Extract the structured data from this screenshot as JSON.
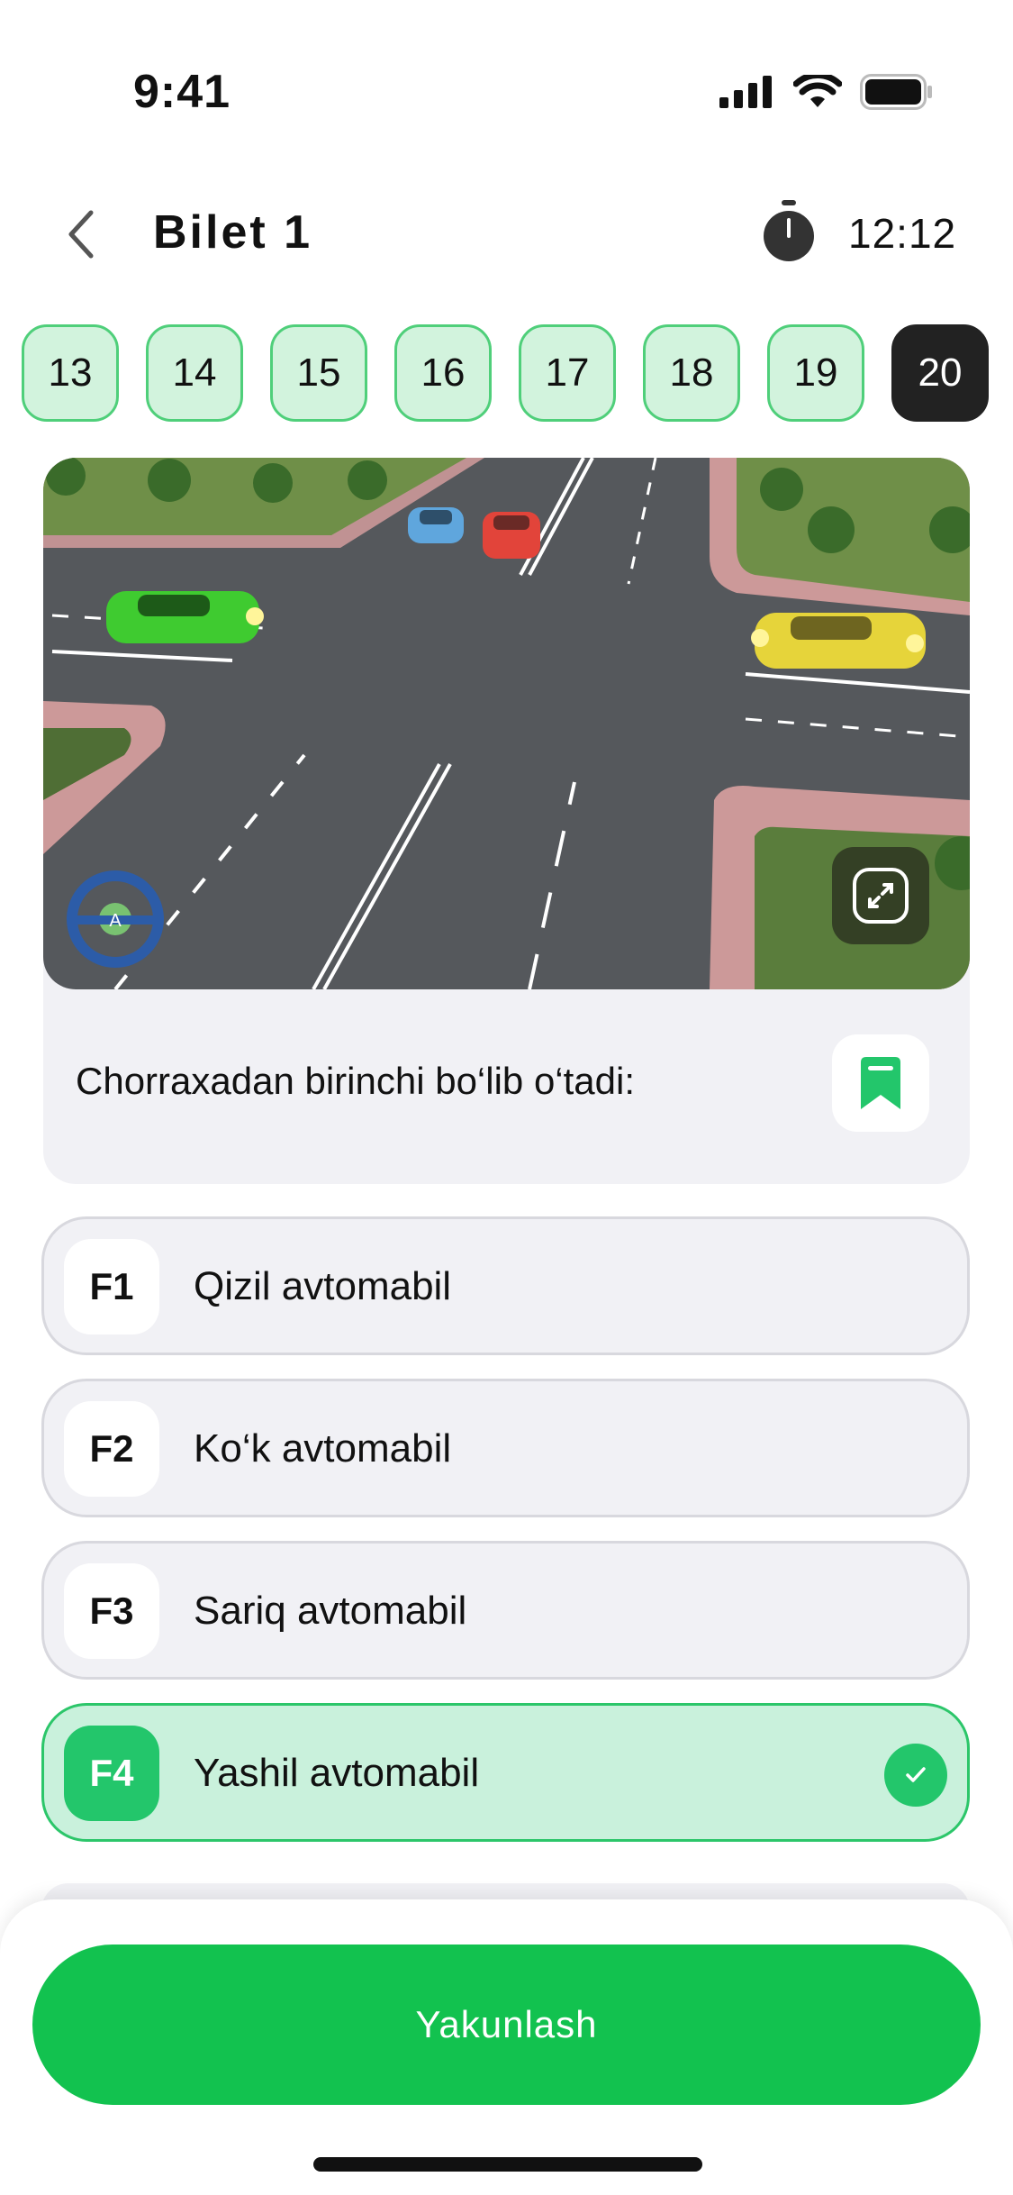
{
  "status_bar": {
    "time": "9:41"
  },
  "header": {
    "title": "Bilet 1",
    "timer": "12:12"
  },
  "question_numbers": [
    {
      "label": "13",
      "active": false
    },
    {
      "label": "14",
      "active": false
    },
    {
      "label": "15",
      "active": false
    },
    {
      "label": "16",
      "active": false
    },
    {
      "label": "17",
      "active": false
    },
    {
      "label": "18",
      "active": false
    },
    {
      "label": "19",
      "active": false
    },
    {
      "label": "20",
      "active": true
    }
  ],
  "question": {
    "text": "Chorraxadan birinchi bo‘lib o‘tadi:",
    "image_badge_letter": "A"
  },
  "answers": [
    {
      "key": "F1",
      "label": "Qizil avtomabil",
      "selected": false
    },
    {
      "key": "F2",
      "label": "Ko‘k avtomabil",
      "selected": false
    },
    {
      "key": "F3",
      "label": "Sariq avtomabil",
      "selected": false
    },
    {
      "key": "F4",
      "label": "Yashil avtomabil",
      "selected": true
    }
  ],
  "footer": {
    "finish_label": "Yakunlash"
  },
  "colors": {
    "accent_green": "#12c24f",
    "chip_fill": "#d2f3dd",
    "chip_border": "#4fcf7a",
    "active_chip": "#222222",
    "selected_answer_fill": "#c9f1dc"
  },
  "icons": [
    "back-chevron-icon",
    "stopwatch-icon",
    "expand-icon",
    "bookmark-icon",
    "check-icon",
    "steering-wheel-icon"
  ]
}
